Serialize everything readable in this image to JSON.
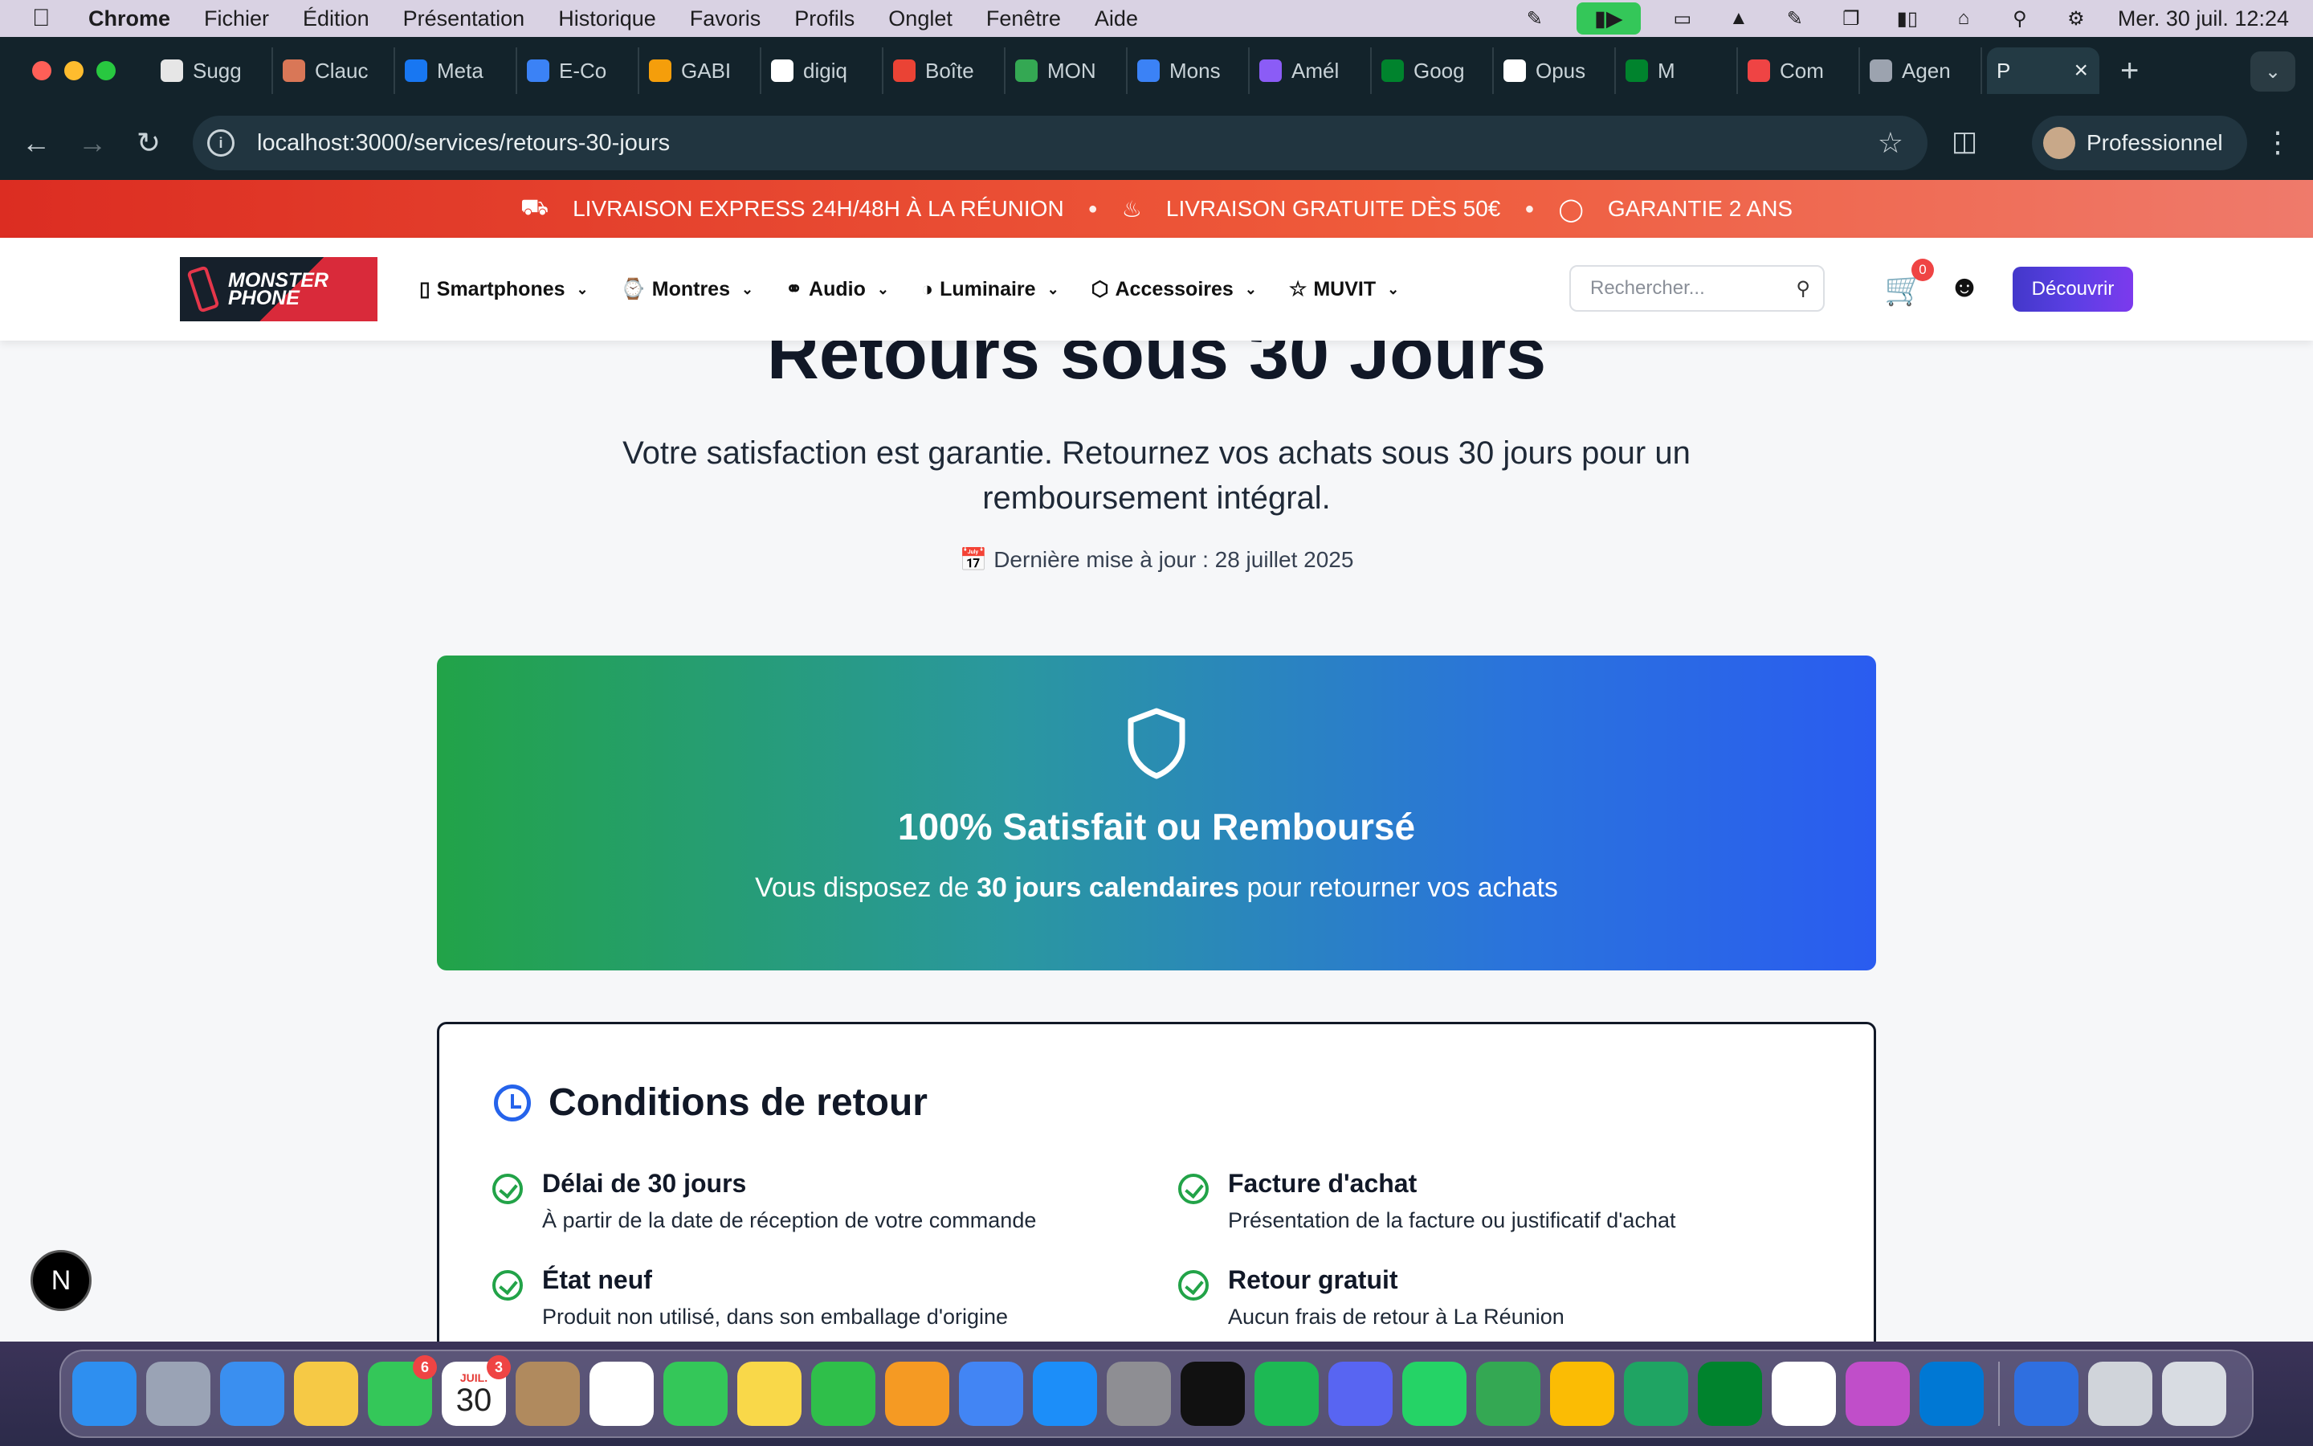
{
  "menubar": {
    "app": "Chrome",
    "items": [
      "Fichier",
      "Édition",
      "Présentation",
      "Historique",
      "Favoris",
      "Profils",
      "Onglet",
      "Fenêtre",
      "Aide"
    ],
    "clock": "Mer. 30 juil.  12:24"
  },
  "browser": {
    "tabs": [
      {
        "label": "Sugg",
        "color": "#e6e6e6"
      },
      {
        "label": "Clauc",
        "color": "#d97757"
      },
      {
        "label": "Meta",
        "color": "#1877f2"
      },
      {
        "label": "E-Co",
        "color": "#3b82f6"
      },
      {
        "label": "GABI",
        "color": "#f59e0b"
      },
      {
        "label": "digiq",
        "color": "#ffffff"
      },
      {
        "label": "Boîte",
        "color": "#ea4335"
      },
      {
        "label": "MON",
        "color": "#34a853"
      },
      {
        "label": "Mons",
        "color": "#3b82f6"
      },
      {
        "label": "Amél",
        "color": "#8b5cf6"
      },
      {
        "label": "Goog",
        "color": "#00832d"
      },
      {
        "label": "Opus",
        "color": "#ffffff"
      },
      {
        "label": "M",
        "color": "#00832d"
      },
      {
        "label": "Com",
        "color": "#ef4444"
      },
      {
        "label": "Agen",
        "color": "#9ca3af"
      }
    ],
    "active_tab": "P",
    "url": "localhost:3000/services/retours-30-jours",
    "profile": "Professionnel"
  },
  "promo": {
    "items": [
      "LIVRAISON EXPRESS 24H/48H À LA RÉUNION",
      "LIVRAISON GRATUITE DÈS 50€",
      "GARANTIE 2 ANS"
    ]
  },
  "header": {
    "logo_line1": "MONSTER",
    "logo_line2": "PHONE",
    "nav": [
      "Smartphones",
      "Montres",
      "Audio",
      "Luminaire",
      "Accessoires",
      "MUVIT"
    ],
    "search_placeholder": "Rechercher...",
    "cart_count": "0",
    "cta": "Découvrir"
  },
  "hero": {
    "title": "Retours sous 30 Jours",
    "subtitle": "Votre satisfaction est garantie. Retournez vos achats sous 30 jours pour un remboursement intégral.",
    "updated": "Dernière mise à jour : 28 juillet 2025"
  },
  "banner": {
    "title": "100% Satisfait ou Remboursé",
    "sub_before": "Vous disposez de ",
    "sub_bold": "30 jours calendaires",
    "sub_after": " pour retourner vos achats"
  },
  "conditions": {
    "title": "Conditions de retour",
    "items": [
      {
        "title": "Délai de 30 jours",
        "desc": "À partir de la date de réception de votre commande"
      },
      {
        "title": "Facture d'achat",
        "desc": "Présentation de la facture ou justificatif d'achat"
      },
      {
        "title": "État neuf",
        "desc": "Produit non utilisé, dans son emballage d'origine"
      },
      {
        "title": "Retour gratuit",
        "desc": "Aucun frais de retour à La Réunion"
      }
    ]
  },
  "devtools_badge": "N",
  "dock": {
    "calendar_month": "JUIL.",
    "calendar_day": "30",
    "badges": {
      "facetime": "6",
      "calendar": "3"
    },
    "apps": [
      {
        "name": "finder-icon",
        "color": "#2e8ff0"
      },
      {
        "name": "launchpad-icon",
        "color": "#9aa3b5"
      },
      {
        "name": "mail-icon",
        "color": "#3a8ff0"
      },
      {
        "name": "photos-icon",
        "color": "#f6c945"
      },
      {
        "name": "facetime-icon",
        "color": "#34c759"
      },
      {
        "name": "calendar-icon",
        "color": "#ffffff"
      },
      {
        "name": "contacts-icon",
        "color": "#b08a5e"
      },
      {
        "name": "reminders-icon",
        "color": "#ffffff"
      },
      {
        "name": "messages-icon",
        "color": "#34c759"
      },
      {
        "name": "notes-icon",
        "color": "#f9d849"
      },
      {
        "name": "numbers-icon",
        "color": "#2fbf4a"
      },
      {
        "name": "pages-icon",
        "color": "#f59a23"
      },
      {
        "name": "chrome-icon",
        "color": "#4285f4"
      },
      {
        "name": "app-store-icon",
        "color": "#1c8ef9"
      },
      {
        "name": "system-settings-icon",
        "color": "#8e8e93"
      },
      {
        "name": "capcut-icon",
        "color": "#111111"
      },
      {
        "name": "spotify-icon",
        "color": "#1db954"
      },
      {
        "name": "discord-icon",
        "color": "#5865f2"
      },
      {
        "name": "whatsapp-icon",
        "color": "#25d366"
      },
      {
        "name": "google-chat-icon",
        "color": "#34a853"
      },
      {
        "name": "google-photos-icon",
        "color": "#fbbc04"
      },
      {
        "name": "google-drive-icon",
        "color": "#1fa463"
      },
      {
        "name": "google-meet-icon",
        "color": "#00832d"
      },
      {
        "name": "slack-icon",
        "color": "#ffffff"
      },
      {
        "name": "imac-icon",
        "color": "#c04ec9"
      },
      {
        "name": "vscode-icon",
        "color": "#0078d4"
      }
    ],
    "extras": [
      {
        "name": "globe-icon",
        "color": "#2f6fe0"
      },
      {
        "name": "minimized-window-icon",
        "color": "#d0d4da"
      },
      {
        "name": "trash-icon",
        "color": "#d8dce2"
      }
    ]
  }
}
